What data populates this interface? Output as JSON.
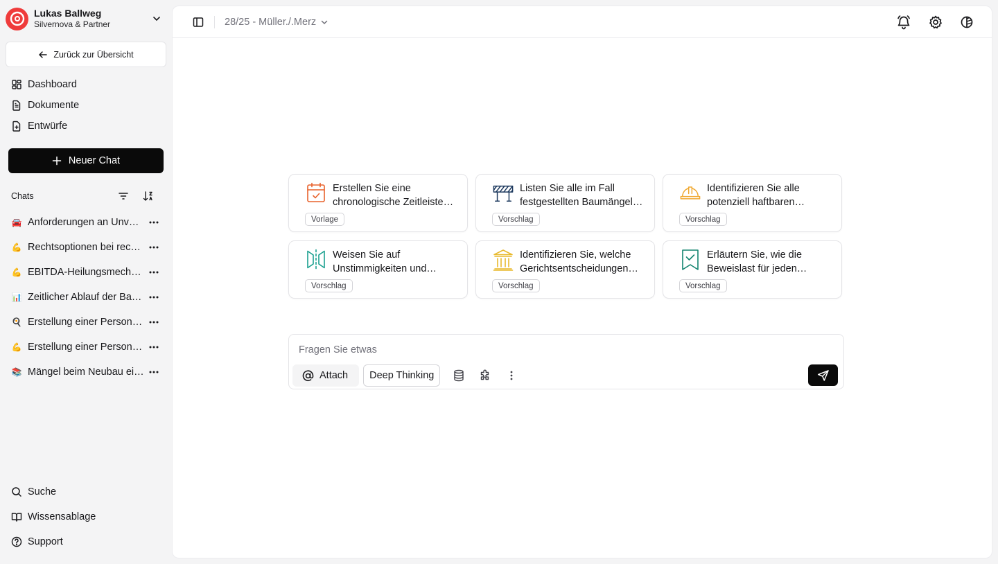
{
  "account": {
    "name": "Lukas Ballweg",
    "org": "Silvernova & Partner"
  },
  "back_button": "Zurück zur Übersicht",
  "nav": [
    {
      "label": "Dashboard",
      "icon": "dashboard-icon"
    },
    {
      "label": "Dokumente",
      "icon": "document-icon"
    },
    {
      "label": "Entwürfe",
      "icon": "draft-icon"
    }
  ],
  "new_chat": "Neuer Chat",
  "chats": {
    "label": "Chats",
    "items": [
      {
        "emoji": "🚘",
        "title": "Anforderungen an Unverhältnismäßigkeit"
      },
      {
        "emoji": "💪",
        "title": "Rechtsoptionen bei rechtlichen Problemen"
      },
      {
        "emoji": "💪",
        "title": "EBITDA-Heilungsmechanismen"
      },
      {
        "emoji": "📊",
        "title": "Zeitlicher Ablauf der Bauarbeiten"
      },
      {
        "emoji": "🍳",
        "title": "Erstellung einer Personenliste"
      },
      {
        "emoji": "💪",
        "title": "Erstellung einer Personenübersicht"
      },
      {
        "emoji": "📚",
        "title": "Mängel beim Neubau eines Hauses"
      }
    ]
  },
  "bottom_nav": [
    {
      "label": "Suche"
    },
    {
      "label": "Wissensablage"
    },
    {
      "label": "Support"
    }
  ],
  "header": {
    "breadcrumb": "28/25 - Müller./.Merz"
  },
  "cards": [
    {
      "text": "Erstellen Sie eine chronologische Zeitleiste aller Ereignisse",
      "badge": "Vorlage",
      "icon": "calendar-check-icon"
    },
    {
      "text": "Listen Sie alle im Fall festgestellten Baumängel auf",
      "badge": "Vorschlag",
      "icon": "construction-barrier-icon"
    },
    {
      "text": "Identifizieren Sie alle potenziell haftbaren Parteien",
      "badge": "Vorschlag",
      "icon": "hard-hat-icon"
    },
    {
      "text": "Weisen Sie auf Unstimmigkeiten und widersprüchliche Aussagen hin",
      "badge": "Vorschlag",
      "icon": "compare-icon"
    },
    {
      "text": "Identifizieren Sie, welche Gerichtsentscheidungen relevant sind",
      "badge": "Vorschlag",
      "icon": "courthouse-icon"
    },
    {
      "text": "Erläutern Sie, wie die Beweislast für jeden Anspruch verteilt ist",
      "badge": "Vorschlag",
      "icon": "bookmark-check-icon"
    }
  ],
  "composer": {
    "placeholder": "Fragen Sie etwas",
    "attach_label": "Attach",
    "deep_thinking_label": "Deep Thinking"
  },
  "colors": {
    "accent_orange": "#e8622c",
    "accent_navy": "#1e3a5f",
    "accent_amber": "#f0a830",
    "accent_teal": "#1aa08f",
    "accent_gold": "#e8b92c",
    "accent_green": "#12836f"
  }
}
